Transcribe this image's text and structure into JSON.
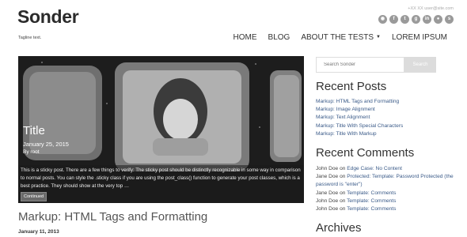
{
  "site": {
    "title": "Sonder",
    "tagline": "Tagline text."
  },
  "header": {
    "contact": "+XX XX user@site.com",
    "social_icons": [
      "github-icon",
      "facebook-icon",
      "twitter-icon",
      "google-plus-icon",
      "linkedin-icon",
      "flickr-icon",
      "skype-icon"
    ]
  },
  "nav": {
    "items": [
      "HOME",
      "BLOG",
      "ABOUT THE TESTS",
      "LOREM IPSUM"
    ]
  },
  "hero": {
    "title": "Title",
    "date": "January 25, 2015",
    "byline": "By root",
    "excerpt": "This is a sticky post. There are a few things to verify: The sticky post should be distinctly recognizable in some way in comparison to normal posts. You can style the .sticky class if you are using the post_class() function to generate your post classes, which is a best practice. They should show at the very top …",
    "button": "Continued"
  },
  "post": {
    "title": "Markup: HTML Tags and Formatting",
    "date": "January 11, 2013"
  },
  "sidebar": {
    "search_placeholder": "Search Sonder",
    "search_button": "Search",
    "recent_posts_title": "Recent Posts",
    "recent_posts": [
      "Markup: HTML Tags and Formatting",
      "Markup: Image Alignment",
      "Markup: Text Alignment",
      "Markup: Title With Special Characters",
      "Markup: Title With Markup"
    ],
    "recent_comments_title": "Recent Comments",
    "recent_comments": [
      {
        "author": "John Doe",
        "on": "on",
        "post": "Edge Case: No Content"
      },
      {
        "author": "Jane Doe",
        "on": "on",
        "post": "Protected: Template: Password Protected (the password is \"enter\")"
      },
      {
        "author": "Jane Doe",
        "on": "on",
        "post": "Template: Comments"
      },
      {
        "author": "John Doe",
        "on": "on",
        "post": "Template: Comments"
      },
      {
        "author": "John Doe",
        "on": "on",
        "post": "Template: Comments"
      }
    ],
    "archives_title": "Archives"
  },
  "colors": {
    "link": "#3a5a88",
    "nav_text": "#333333",
    "hero_overlay": "#191919",
    "search_button": "#dcdcdc"
  }
}
